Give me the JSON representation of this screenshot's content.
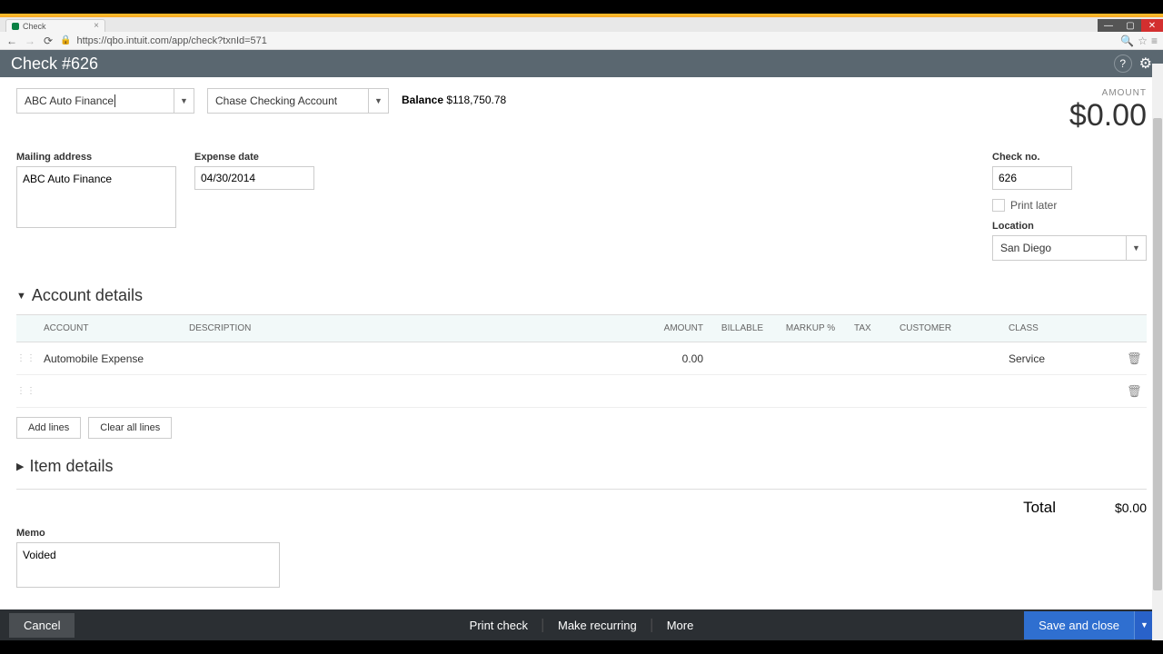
{
  "browser": {
    "tab_title": "Check",
    "url": "https://qbo.intuit.com/app/check?txnId=571"
  },
  "header": {
    "title": "Check #626"
  },
  "form": {
    "payee": "ABC Auto Finance",
    "account": "Chase Checking Account",
    "balance_label": "Balance",
    "balance_value": "$118,750.78",
    "amount_label": "AMOUNT",
    "amount_value": "$0.00",
    "mailing_label": "Mailing address",
    "mailing_value": "ABC Auto Finance",
    "expense_date_label": "Expense date",
    "expense_date_value": "04/30/2014",
    "check_no_label": "Check no.",
    "check_no_value": "626",
    "print_later_label": "Print later",
    "location_label": "Location",
    "location_value": "San Diego"
  },
  "account_details": {
    "title": "Account details",
    "columns": {
      "account": "ACCOUNT",
      "description": "DESCRIPTION",
      "amount": "AMOUNT",
      "billable": "BILLABLE",
      "markup": "MARKUP %",
      "tax": "TAX",
      "customer": "CUSTOMER",
      "class": "CLASS"
    },
    "rows": [
      {
        "account": "Automobile Expense",
        "description": "",
        "amount": "0.00",
        "class": "Service"
      },
      {
        "account": "",
        "description": "",
        "amount": "",
        "class": ""
      }
    ],
    "add_lines": "Add lines",
    "clear_lines": "Clear all lines"
  },
  "item_details": {
    "title": "Item details"
  },
  "totals": {
    "label": "Total",
    "value": "$0.00"
  },
  "memo": {
    "label": "Memo",
    "value": "Voided"
  },
  "footer": {
    "cancel": "Cancel",
    "print": "Print check",
    "recurring": "Make recurring",
    "more": "More",
    "save": "Save and close"
  }
}
